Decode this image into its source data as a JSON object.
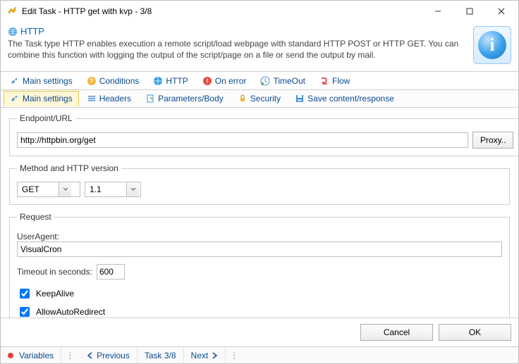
{
  "window": {
    "title": "Edit Task - HTTP get with kvp - 3/8"
  },
  "header": {
    "title": "HTTP",
    "desc": "The Task type HTTP enables execution a remote script/load webpage with standard HTTP POST or HTTP GET. You can combine this function with logging the output of the script/page on a file or send the output by mail."
  },
  "tabs": {
    "main_settings": "Main settings",
    "conditions": "Conditions",
    "http": "HTTP",
    "on_error": "On error",
    "timeout": "TimeOut",
    "flow": "Flow"
  },
  "subtabs": {
    "main_settings": "Main settings",
    "headers": "Headers",
    "parameters_body": "Parameters/Body",
    "security": "Security",
    "save_content": "Save content/response"
  },
  "endpoint": {
    "legend": "Endpoint/URL",
    "value": "http://httpbin.org/get",
    "proxy_btn": "Proxy.."
  },
  "method": {
    "legend": "Method and HTTP version",
    "method_value": "GET",
    "version_value": "1.1"
  },
  "request": {
    "legend": "Request",
    "useragent_label": "UserAgent:",
    "useragent_value": "VisualCron",
    "timeout_label": "Timeout in seconds:",
    "timeout_value": "600",
    "keepalive_label": "KeepAlive",
    "keepalive_checked": true,
    "autoredirect_label": "AllowAutoRedirect",
    "autoredirect_checked": true
  },
  "footer": {
    "cancel": "Cancel",
    "ok": "OK"
  },
  "status": {
    "variables": "Variables",
    "previous": "Previous",
    "position": "Task 3/8",
    "next": "Next"
  }
}
